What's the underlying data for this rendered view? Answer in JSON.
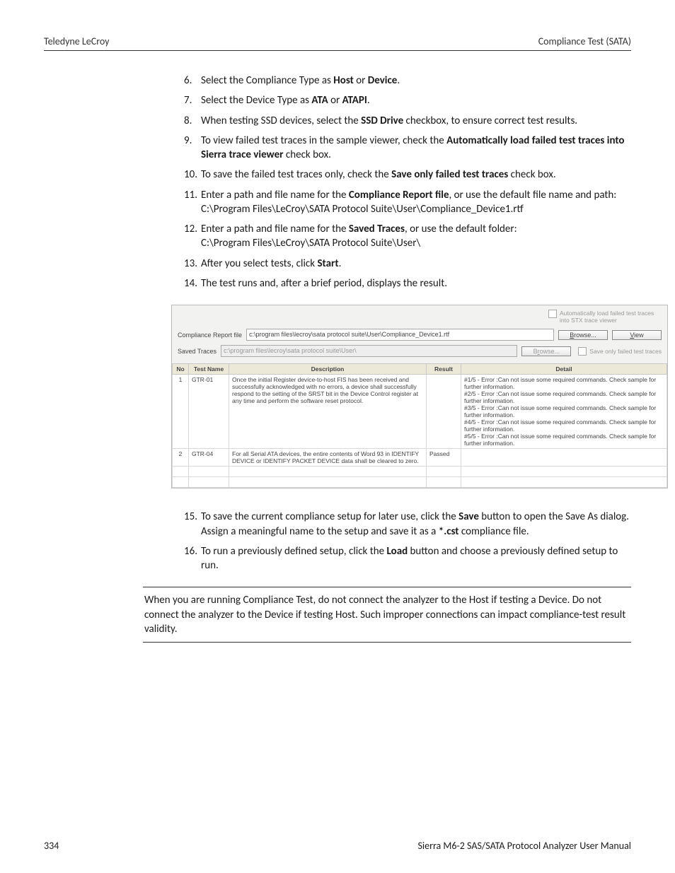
{
  "header": {
    "left": "Teledyne LeCroy",
    "right": "Compliance Test (SATA)"
  },
  "list1": [
    {
      "n": "6.",
      "parts": [
        "Select the Compliance Type as ",
        "Host",
        " or ",
        "Device",
        "."
      ]
    },
    {
      "n": "7.",
      "parts": [
        "Select the Device Type as ",
        "ATA",
        " or ",
        "ATAPI",
        "."
      ]
    },
    {
      "n": "8.",
      "parts": [
        "When testing SSD devices, select the ",
        "SSD Drive",
        " checkbox, to ensure correct test results."
      ]
    },
    {
      "n": "9.",
      "parts": [
        "To view failed test traces in the sample viewer, check the ",
        "Automatically load failed test traces into Sierra trace viewer",
        " check box."
      ]
    },
    {
      "n": "10.",
      "parts": [
        "To save the failed test traces only, check the ",
        "Save only failed test traces",
        " check box."
      ]
    },
    {
      "n": "11.",
      "parts": [
        "Enter a path and file name for the ",
        "Compliance Report file",
        ", or use the default file name and path:\nC:\\Program Files\\LeCroy\\SATA Protocol Suite\\User\\Compliance_Device1.rtf"
      ]
    },
    {
      "n": "12.",
      "parts": [
        "Enter a path and file name for the ",
        "Saved Traces",
        ", or use the default folder:\nC:\\Program Files\\LeCroy\\SATA Protocol Suite\\User\\"
      ]
    },
    {
      "n": "13.",
      "parts": [
        "After you select tests, click ",
        "Start",
        "."
      ]
    },
    {
      "n": "14.",
      "parts": [
        "The test runs and, after a brief period, displays the result."
      ]
    }
  ],
  "screenshot": {
    "top_checkbox": "Automatically load failed test traces into STX trace viewer",
    "report_label": "Compliance Report file",
    "report_value": "c:\\program files\\lecroy\\sata protocol suite\\User\\Compliance_Device1.rtf",
    "traces_label": "Saved Traces",
    "traces_value": "c:\\program files\\lecroy\\sata protocol suite\\User\\",
    "browse": "Browse...",
    "view": "View",
    "save_only": "Save only failed test traces",
    "columns": [
      "No",
      "Test Name",
      "Description",
      "Result",
      "Detail"
    ],
    "rows": [
      {
        "no": "1",
        "name": "GTR-01",
        "desc": "Once the initial Register device-to-host FIS has been received and successfully acknowledged with no errors, a device shall successfully respond to the setting of the SRST bit in the Device Control register at any time and perform the software reset protocol.",
        "result": "",
        "detail": "#1/5 - Error :Can not issue some required commands. Check sample for further information.\n#2/5 - Error :Can not issue some required commands. Check sample for further information.\n#3/5 - Error :Can not issue some required commands. Check sample for further information.\n#4/5 - Error :Can not issue some required commands. Check sample for further information.\n#5/5 - Error :Can not issue some required commands. Check sample for further information."
      },
      {
        "no": "2",
        "name": "GTR-04",
        "desc": "For all Serial ATA devices, the entire contents of Word 93 in IDENTIFY DEVICE or IDENTIFY PACKET DEVICE data shall be cleared to zero.",
        "result": "Passed",
        "detail": ""
      }
    ]
  },
  "list2": [
    {
      "n": "15.",
      "parts": [
        "To save the current compliance setup for later use, click the ",
        "Save",
        " button to open the Save As dialog. Assign a meaningful name to the setup and save it as a ",
        "*.cst",
        " compliance file."
      ]
    },
    {
      "n": "16.",
      "parts": [
        "To run a previously defined setup, click the ",
        "Load",
        " button and choose a previously defined setup to run."
      ]
    }
  ],
  "note": "When you are running Compliance Test, do not connect the analyzer to the Host if testing a Device. Do not connect the analyzer to the Device if testing Host. Such improper connections can impact compliance-test result validity.",
  "footer": {
    "left": "334",
    "right": "Sierra M6-2 SAS/SATA Protocol Analyzer User Manual"
  }
}
